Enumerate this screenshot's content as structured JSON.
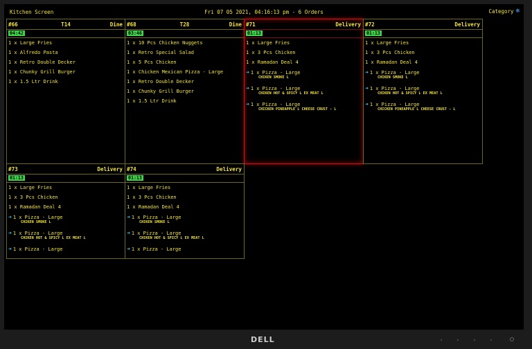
{
  "header": {
    "app_title": "Kitchen Screen",
    "clock": "Fri 07 05 2021, 04:16:13 pm - 6 Orders",
    "category_label": "Category"
  },
  "bezel": {
    "brand": "DELL"
  },
  "orders": [
    {
      "number": "#66",
      "table": "T14",
      "type": "Dine",
      "timer": "04:42",
      "highlight": false,
      "items": [
        {
          "text": "1 x Large Fries"
        },
        {
          "text": "1 x Alfredo Pasta"
        },
        {
          "text": "1 x Retro Double Decker"
        },
        {
          "text": "1 x Chunky Grill Burger"
        },
        {
          "text": "1 x 1.5 Ltr Drink"
        }
      ]
    },
    {
      "number": "#68",
      "table": "T28",
      "type": "Dine",
      "timer": "03:46",
      "highlight": false,
      "items": [
        {
          "text": "1 x 10 Pcs Chicken Nuggets"
        },
        {
          "text": "1 x Retro Special Salad"
        },
        {
          "text": "1 x 5 Pcs Chicken"
        },
        {
          "text": "1 x Chicken Mexican Pizza - Large"
        },
        {
          "text": "1 x Retro Double Decker"
        },
        {
          "text": "1 x Chunky Grill Burger"
        },
        {
          "text": "1 x 1.5 Ltr Drink"
        }
      ]
    },
    {
      "number": "#71",
      "table": "",
      "type": "Delivery",
      "timer": "01:13",
      "highlight": true,
      "items": [
        {
          "text": "1 x Large Fries"
        },
        {
          "text": "1 x 3 Pcs Chicken"
        },
        {
          "text": "1 x Ramadan Deal 4"
        },
        {
          "text": "1 x Pizza - Large",
          "arrow": true,
          "mod": "CHIKEN SMOKE L"
        },
        {
          "text": "1 x Pizza - Large",
          "arrow": true,
          "mod": "CHIKEN HOT & SPICY L EX MEAT L"
        },
        {
          "text": "1 x Pizza - Large",
          "arrow": true,
          "mod": "CHICKEN PINEAPPLE L CHEESE CRUST - L"
        }
      ]
    },
    {
      "number": "#72",
      "table": "",
      "type": "Delivery",
      "timer": "01:13",
      "highlight": false,
      "items": [
        {
          "text": "1 x Large Fries"
        },
        {
          "text": "1 x 3 Pcs Chicken"
        },
        {
          "text": "1 x Ramadan Deal 4"
        },
        {
          "text": "1 x Pizza - Large",
          "arrow": true,
          "mod": "CHIKEN SMOKE L"
        },
        {
          "text": "1 x Pizza - Large",
          "arrow": true,
          "mod": "CHIKEN HOT & SPICY L EX MEAT L"
        },
        {
          "text": "1 x Pizza - Large",
          "arrow": true,
          "mod": "CHICKEN PINEAPPLE L CHEESE CRUST - L"
        }
      ]
    },
    {
      "number": "#73",
      "table": "",
      "type": "Delivery",
      "timer": "01:13",
      "highlight": false,
      "items": [
        {
          "text": "1 x Large Fries"
        },
        {
          "text": "1 x 3 Pcs Chicken"
        },
        {
          "text": "1 x Ramadan Deal 4"
        },
        {
          "text": "1 x Pizza - Large",
          "arrow": true,
          "mod": "CHIKEN SMOKE L"
        },
        {
          "text": "1 x Pizza - Large",
          "arrow": true,
          "mod": "CHIKEN HOT & SPICY L EX MEAT L"
        },
        {
          "text": "1 x Pizza - Large",
          "arrow": true
        }
      ]
    },
    {
      "number": "#74",
      "table": "",
      "type": "Delivery",
      "timer": "01:13",
      "highlight": false,
      "items": [
        {
          "text": "1 x Large Fries"
        },
        {
          "text": "1 x 3 Pcs Chicken"
        },
        {
          "text": "1 x Ramadan Deal 4"
        },
        {
          "text": "1 x Pizza - Large",
          "arrow": true,
          "mod": "CHIKEN SMOKE L"
        },
        {
          "text": "1 x Pizza - Large",
          "arrow": true,
          "mod": "CHIKEN HOT & SPICY L EX MEAT L"
        },
        {
          "text": "1 x Pizza - Large",
          "arrow": true
        }
      ]
    }
  ],
  "colors": {
    "text": "#f2e33a",
    "timer": "#3ed64a",
    "arrow": "#3ac8f0",
    "alert": "#d01010",
    "gear": "#4aa3ff"
  },
  "icons": {
    "category": "gear-icon",
    "modifier_arrow": "arrow-right-icon"
  }
}
